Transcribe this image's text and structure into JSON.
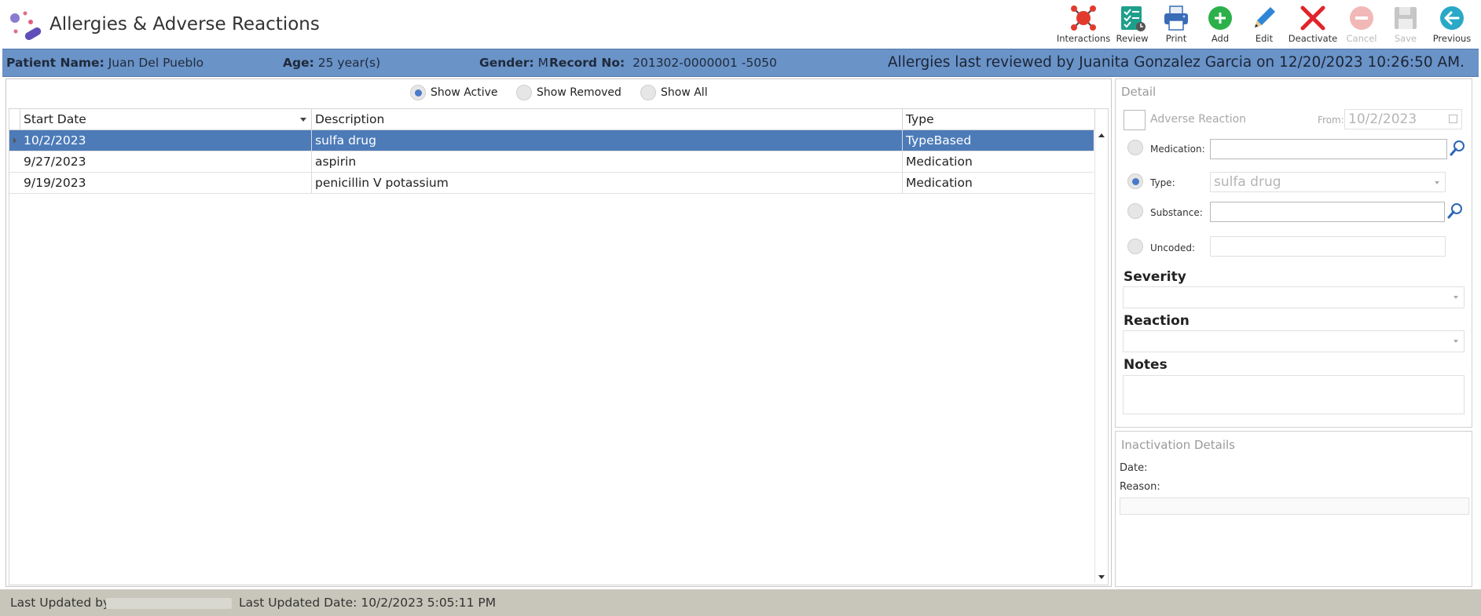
{
  "app": {
    "title": "Allergies & Adverse Reactions"
  },
  "toolbar": {
    "buttons": [
      {
        "label": "Interactions",
        "icon": "interactions-icon",
        "enabled": true
      },
      {
        "label": "Review",
        "icon": "review-checklist-icon",
        "enabled": true
      },
      {
        "label": "Print",
        "icon": "printer-icon",
        "enabled": true
      },
      {
        "label": "Add",
        "icon": "add-circle-icon",
        "enabled": true
      },
      {
        "label": "Edit",
        "icon": "pencil-icon",
        "enabled": true
      },
      {
        "label": "Deactivate",
        "icon": "x-mark-icon",
        "enabled": true
      },
      {
        "label": "Cancel",
        "icon": "cancel-minus-icon",
        "enabled": false
      },
      {
        "label": "Save",
        "icon": "floppy-disk-icon",
        "enabled": false
      },
      {
        "label": "Previous",
        "icon": "arrow-left-circle-icon",
        "enabled": true
      }
    ]
  },
  "patient": {
    "name_label": "Patient Name:",
    "name": "Juan Del Pueblo",
    "age_label": "Age:",
    "age": "25 year(s)",
    "gender_label": "Gender:",
    "gender": "M",
    "record_label": "Record No:",
    "record": "201302-0000001 -5050",
    "review_text": "Allergies last reviewed by Juanita Gonzalez Garcia on 12/20/2023 10:26:50 AM."
  },
  "filters": {
    "options": [
      "Show Active",
      "Show Removed",
      "Show All"
    ],
    "selected": "Show Active"
  },
  "grid": {
    "columns": [
      "Start Date",
      "Description",
      "Type"
    ],
    "rows": [
      {
        "start_date": "10/2/2023",
        "description": "sulfa drug",
        "type": "TypeBased",
        "selected": true
      },
      {
        "start_date": "9/27/2023",
        "description": "aspirin",
        "type": "Medication",
        "selected": false
      },
      {
        "start_date": "9/19/2023",
        "description": "penicillin V potassium",
        "type": "Medication",
        "selected": false
      }
    ]
  },
  "detail": {
    "title": "Detail",
    "adverse_reaction_label": "Adverse Reaction",
    "from_label": "From:",
    "from_value": "10/2/2023",
    "medication_label": "Medication:",
    "medication_value": "",
    "type_label": "Type:",
    "type_value": "sulfa drug",
    "substance_label": "Substance:",
    "substance_value": "",
    "uncoded_label": "Uncoded:",
    "uncoded_value": "",
    "selected_source": "Type",
    "severity_label": "Severity",
    "reaction_label": "Reaction",
    "notes_label": "Notes"
  },
  "inactivation": {
    "title": "Inactivation Details",
    "date_label": "Date:",
    "reason_label": "Reason:"
  },
  "footer": {
    "updated_by_label": "Last Updated by:",
    "updated_date_label": "Last Updated Date:",
    "updated_date": "10/2/2023 5:05:11 PM"
  },
  "colors": {
    "patient_bar": "#6a93c8",
    "selected_row": "#4d7bb8",
    "footer": "#c8c6ba",
    "add_green": "#2bb04a",
    "deactivate_red": "#e0242a",
    "previous_teal": "#2aa8c8"
  }
}
